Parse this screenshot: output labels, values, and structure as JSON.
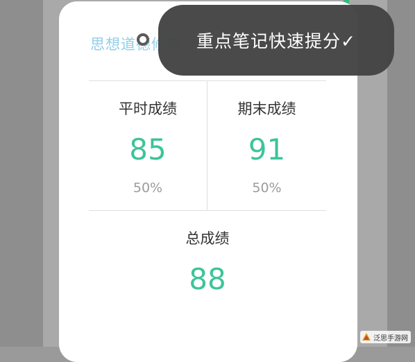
{
  "app": {
    "subject_title": "思想道德修养"
  },
  "toast": {
    "message": "重点笔记快速提分✓"
  },
  "scores": {
    "regular": {
      "label": "平时成绩",
      "score": "85",
      "weight": "50%"
    },
    "final": {
      "label": "期末成绩",
      "score": "91",
      "weight": "50%"
    },
    "total": {
      "label": "总成绩",
      "score": "88"
    }
  },
  "watermark": {
    "text": "泛思手游网"
  },
  "colors": {
    "score_green": "#3cc49a",
    "title_blue": "#8ecfea",
    "toast_bg": "#444444",
    "tab_green": "#37b878"
  }
}
